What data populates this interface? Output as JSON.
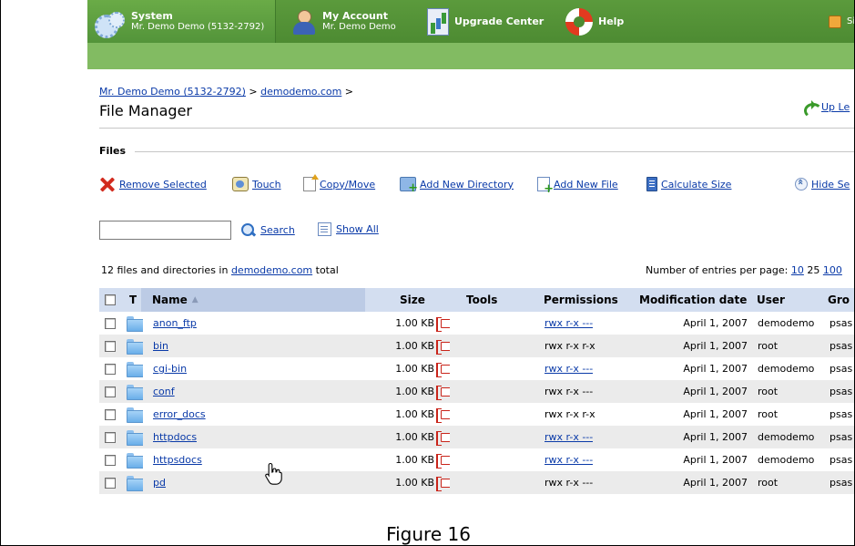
{
  "nav": {
    "system": {
      "title": "System",
      "subtitle": "Mr. Demo Demo (5132-2792)"
    },
    "account": {
      "title": "My Account",
      "subtitle": "Mr. Demo Demo"
    },
    "upgrade": {
      "title": "Upgrade Center"
    },
    "help": {
      "title": "Help"
    },
    "signout": {
      "label": "Si"
    }
  },
  "breadcrumb": {
    "client": "Mr. Demo Demo (5132-2792)",
    "sep1": " > ",
    "domain": "demodemo.com",
    "sep2": " >"
  },
  "page_title": "File Manager",
  "up_level": "Up Le",
  "section_title": "Files",
  "toolbar": {
    "remove": "Remove Selected",
    "touch": "Touch",
    "copy": "Copy/Move",
    "add_dir": "Add New Directory",
    "add_file": "Add New File",
    "calc": "Calculate Size",
    "hide": "Hide Se"
  },
  "search": {
    "value": "",
    "label": "Search",
    "show_all": "Show All"
  },
  "summary": {
    "prefix": "12 files and directories in ",
    "domain": "demodemo.com",
    "suffix": " total"
  },
  "per_page": {
    "label": "Number of entries per page: ",
    "opt10": "10",
    "opt25": "25",
    "opt100": "100"
  },
  "columns": {
    "t": "T",
    "name": "Name",
    "size": "Size",
    "tools": "Tools",
    "perm": "Permissions",
    "mod": "Modification date",
    "user": "User",
    "group": "Gro"
  },
  "rows": [
    {
      "name": "anon_ftp",
      "size": "1.00 KB",
      "perm": "rwx r-x ---",
      "perm_link": true,
      "date": "April 1, 2007",
      "user": "demodemo",
      "group": "psas"
    },
    {
      "name": "bin",
      "size": "1.00 KB",
      "perm": "rwx r-x r-x",
      "perm_link": false,
      "date": "April 1, 2007",
      "user": "root",
      "group": "psas"
    },
    {
      "name": "cgi-bin",
      "size": "1.00 KB",
      "perm": "rwx r-x ---",
      "perm_link": true,
      "date": "April 1, 2007",
      "user": "demodemo",
      "group": "psas"
    },
    {
      "name": "conf",
      "size": "1.00 KB",
      "perm": "rwx r-x ---",
      "perm_link": false,
      "date": "April 1, 2007",
      "user": "root",
      "group": "psas"
    },
    {
      "name": "error_docs",
      "size": "1.00 KB",
      "perm": "rwx r-x r-x",
      "perm_link": false,
      "date": "April 1, 2007",
      "user": "root",
      "group": "psas"
    },
    {
      "name": "httpdocs",
      "size": "1.00 KB",
      "perm": "rwx r-x ---",
      "perm_link": true,
      "date": "April 1, 2007",
      "user": "demodemo",
      "group": "psas"
    },
    {
      "name": "httpsdocs",
      "size": "1.00 KB",
      "perm": "rwx r-x ---",
      "perm_link": true,
      "date": "April 1, 2007",
      "user": "demodemo",
      "group": "psas"
    },
    {
      "name": "pd",
      "size": "1.00 KB",
      "perm": "rwx r-x ---",
      "perm_link": false,
      "date": "April 1, 2007",
      "user": "root",
      "group": "psas"
    }
  ],
  "caption": "Figure 16",
  "colors": {
    "nav_green": "#4d8b32",
    "header_blue": "#d3def0",
    "link": "#0a3aa8"
  }
}
